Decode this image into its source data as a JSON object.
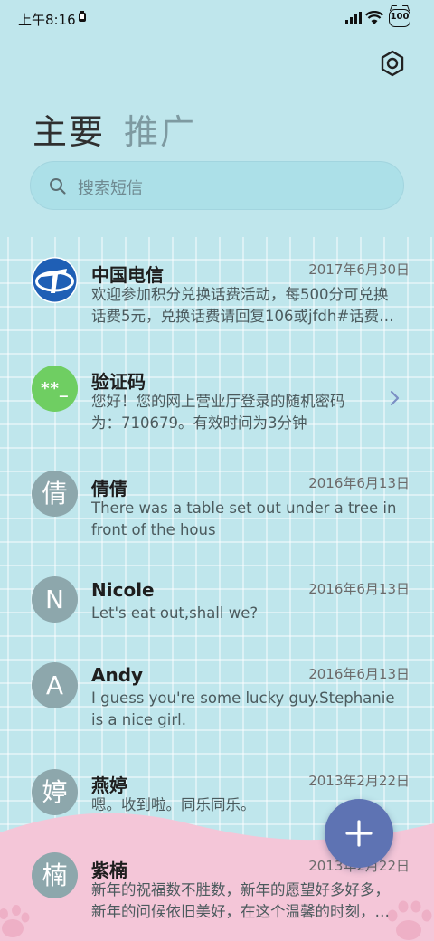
{
  "status": {
    "time": "上午8:16",
    "battery": "100"
  },
  "tabs": {
    "primary": "主要",
    "promo": "推广"
  },
  "search": {
    "placeholder": "搜索短信"
  },
  "conversations": [
    {
      "sender": "中国电信",
      "date": "2017年6月30日",
      "line1": "欢迎参加积分兑换话费活动，每500分可兑换",
      "line2": "话费5元，兑换话费请回复106或jfdh#话费…",
      "avatar": "telecom-logo"
    },
    {
      "sender": "验证码",
      "date": "",
      "line1": "您好！您的网上营业厅登录的随机密码",
      "line2": "为：710679。有效时间为3分钟",
      "avatar_text": "**_"
    },
    {
      "sender": "倩倩",
      "date": "2016年6月13日",
      "line1": "There was a table set out under a tree in",
      "line2": "front of the hous",
      "avatar_text": "倩"
    },
    {
      "sender": "Nicole",
      "date": "2016年6月13日",
      "line1": "Let's eat out,shall we?",
      "line2": "",
      "avatar_text": "N"
    },
    {
      "sender": "Andy",
      "date": "2016年6月13日",
      "line1": "I guess you're some lucky guy.Stephanie",
      "line2": "is a nice girl.",
      "avatar_text": "A"
    },
    {
      "sender": "燕婷",
      "date": "2013年2月22日",
      "line1": "嗯。收到啦。同乐同乐。",
      "line2": "",
      "avatar_text": "婷"
    },
    {
      "sender": "紫楠",
      "date": "2013年2月22日",
      "line1": "新年的祝福数不胜数，新年的愿望好多好多，",
      "line2": "新年的问候依旧美好，在这个温馨的时刻，…",
      "avatar_text": "楠"
    }
  ],
  "colors": {
    "background": "#bfe6ec",
    "fab": "#5e73b3",
    "wave": "#f4c6d8",
    "code_avatar": "#6fce62"
  },
  "icons": [
    "signal-icon",
    "wifi-icon",
    "battery-icon",
    "settings-icon",
    "search-icon",
    "chevron-right-icon",
    "plus-icon",
    "paw-icon"
  ]
}
